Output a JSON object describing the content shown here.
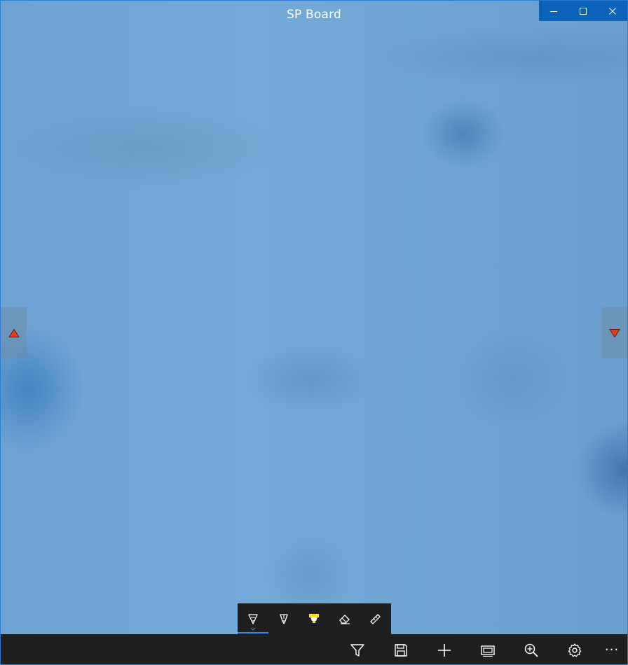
{
  "window": {
    "title": "SP Board",
    "accent": "#0b63b8",
    "caption_buttons": [
      "minimize-icon",
      "maximize-icon",
      "close-icon"
    ]
  },
  "navigation": {
    "previous_icon": "triangle-up-icon",
    "next_icon": "triangle-down-icon",
    "arrow_color": "#e0401a"
  },
  "ink_toolbar": {
    "tools": [
      {
        "icon": "ballpoint-pen-icon",
        "selected": true
      },
      {
        "icon": "pencil-icon",
        "selected": false
      },
      {
        "icon": "highlighter-icon",
        "selected": false,
        "color": "#ffe600"
      },
      {
        "icon": "eraser-icon",
        "selected": false
      },
      {
        "icon": "ruler-icon",
        "selected": false
      }
    ]
  },
  "command_bar": {
    "commands": [
      "filter-icon",
      "save-icon",
      "add-icon",
      "slides-icon",
      "zoom-in-icon",
      "settings-icon",
      "more-icon"
    ],
    "more_label": "···"
  }
}
